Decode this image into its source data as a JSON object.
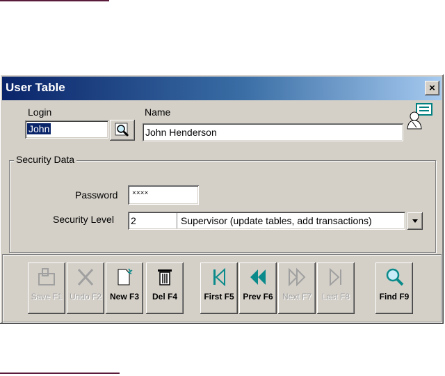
{
  "window": {
    "title": "User Table",
    "close_label": "×"
  },
  "login": {
    "label": "Login",
    "value": "John"
  },
  "name": {
    "label": "Name",
    "value": "John Henderson"
  },
  "security": {
    "legend": "Security Data",
    "password_label": "Password",
    "password_value": "××××",
    "level_label": "Security Level",
    "level_value": "2",
    "level_description": "Supervisor (update tables, add transactions)"
  },
  "toolbar": {
    "buttons": [
      {
        "label": "Save F1",
        "icon": "save-icon",
        "enabled": false
      },
      {
        "label": "Undo F2",
        "icon": "undo-icon",
        "enabled": false
      },
      {
        "label": "New F3",
        "icon": "new-record-icon",
        "enabled": true
      },
      {
        "label": "Del F4",
        "icon": "trash-icon",
        "enabled": true
      },
      {
        "label": "First F5",
        "icon": "first-record-icon",
        "enabled": true
      },
      {
        "label": "Prev F6",
        "icon": "prev-record-icon",
        "enabled": true
      },
      {
        "label": "Next F7",
        "icon": "next-record-icon",
        "enabled": false
      },
      {
        "label": "Last F8",
        "icon": "last-record-icon",
        "enabled": false
      },
      {
        "label": "Find F9",
        "icon": "find-icon",
        "enabled": true
      }
    ]
  },
  "colors": {
    "titlebar_start": "#0a246a",
    "titlebar_end": "#a6caf0",
    "window_bg": "#d4d0c8",
    "nav_accent": "#0a8a8a"
  }
}
